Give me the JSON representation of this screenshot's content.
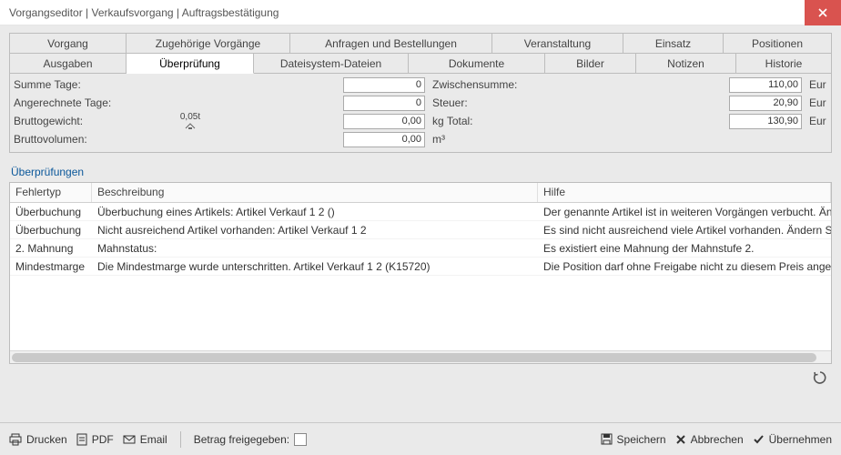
{
  "window": {
    "title": "Vorgangseditor | Verkaufsvorgang | Auftragsbestätigung"
  },
  "tabs": {
    "row1": [
      "Vorgang",
      "Zugehörige Vorgänge",
      "Anfragen und Bestellungen",
      "Veranstaltung",
      "Einsatz",
      "Positionen"
    ],
    "row2": [
      "Ausgaben",
      "Überprüfung",
      "Dateisystem-Dateien",
      "Dokumente",
      "Bilder",
      "Notizen",
      "Historie"
    ],
    "active": "Überprüfung"
  },
  "summary": {
    "labels": {
      "summe_tage": "Summe Tage:",
      "angerechnete_tage": "Angerechnete Tage:",
      "bruttogewicht": "Bruttogewicht:",
      "bruttovolumen": "Bruttovolumen:",
      "zwischensumme": "Zwischensumme:",
      "steuer": "Steuer:",
      "total": "Total:"
    },
    "values": {
      "summe_tage": "0",
      "angerechnete_tage": "0",
      "bruttogewicht": "0,00",
      "bruttovolumen": "0,00",
      "zwischensumme": "110,00",
      "steuer": "20,90",
      "total": "130,90"
    },
    "units": {
      "kg": "kg",
      "m3": "m³",
      "eur": "Eur"
    },
    "weight_icon_text": "0,05t"
  },
  "checks": {
    "section_title": "Überprüfungen",
    "columns": {
      "type": "Fehlertyp",
      "desc": "Beschreibung",
      "help": "Hilfe"
    },
    "rows": [
      {
        "type": "Überbuchung",
        "desc": "Überbuchung eines Artikels: Artikel Verkauf 1 2 ()",
        "help": "Der genannte Artikel ist in weiteren Vorgängen verbucht. Ändern Sie die"
      },
      {
        "type": "Überbuchung",
        "desc": "Nicht ausreichend Artikel vorhanden: Artikel Verkauf 1 2",
        "help": "Es sind nicht ausreichend viele Artikel vorhanden. Ändern Sie die Anzahl"
      },
      {
        "type": "2. Mahnung",
        "desc": "Mahnstatus:",
        "help": "Es existiert eine Mahnung der Mahnstufe 2."
      },
      {
        "type": "Mindestmarge",
        "desc": "Die Mindestmarge wurde unterschritten. Artikel Verkauf 1 2 (K15720)",
        "help": "Die Position darf ohne Freigabe nicht zu diesem Preis angeboten werden"
      }
    ]
  },
  "footer": {
    "drucken": "Drucken",
    "pdf": "PDF",
    "email": "Email",
    "betrag_freigegeben": "Betrag freigegeben:",
    "speichern": "Speichern",
    "abbrechen": "Abbrechen",
    "uebernehmen": "Übernehmen"
  }
}
